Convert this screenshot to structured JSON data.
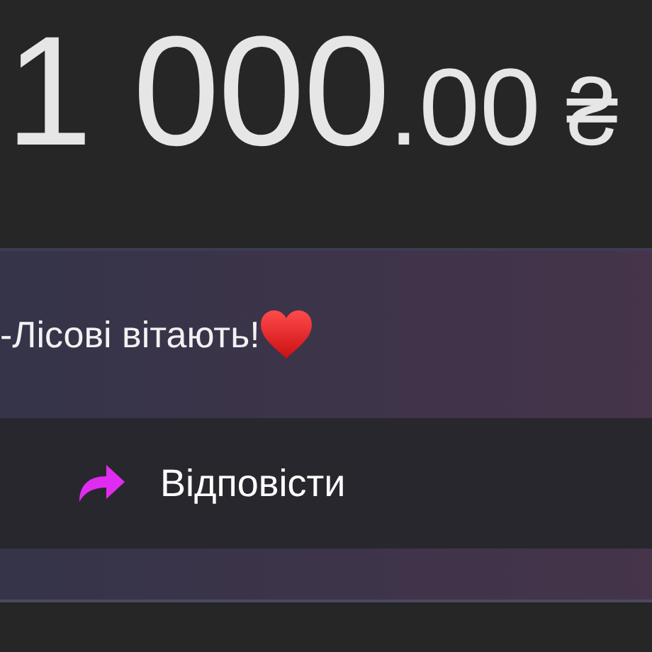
{
  "amount": {
    "integer": "1 000",
    "fraction": ".00",
    "currency": "₴"
  },
  "message": {
    "text": "-Лісові вітають!"
  },
  "reply_button": {
    "label": "Відповісти"
  }
}
